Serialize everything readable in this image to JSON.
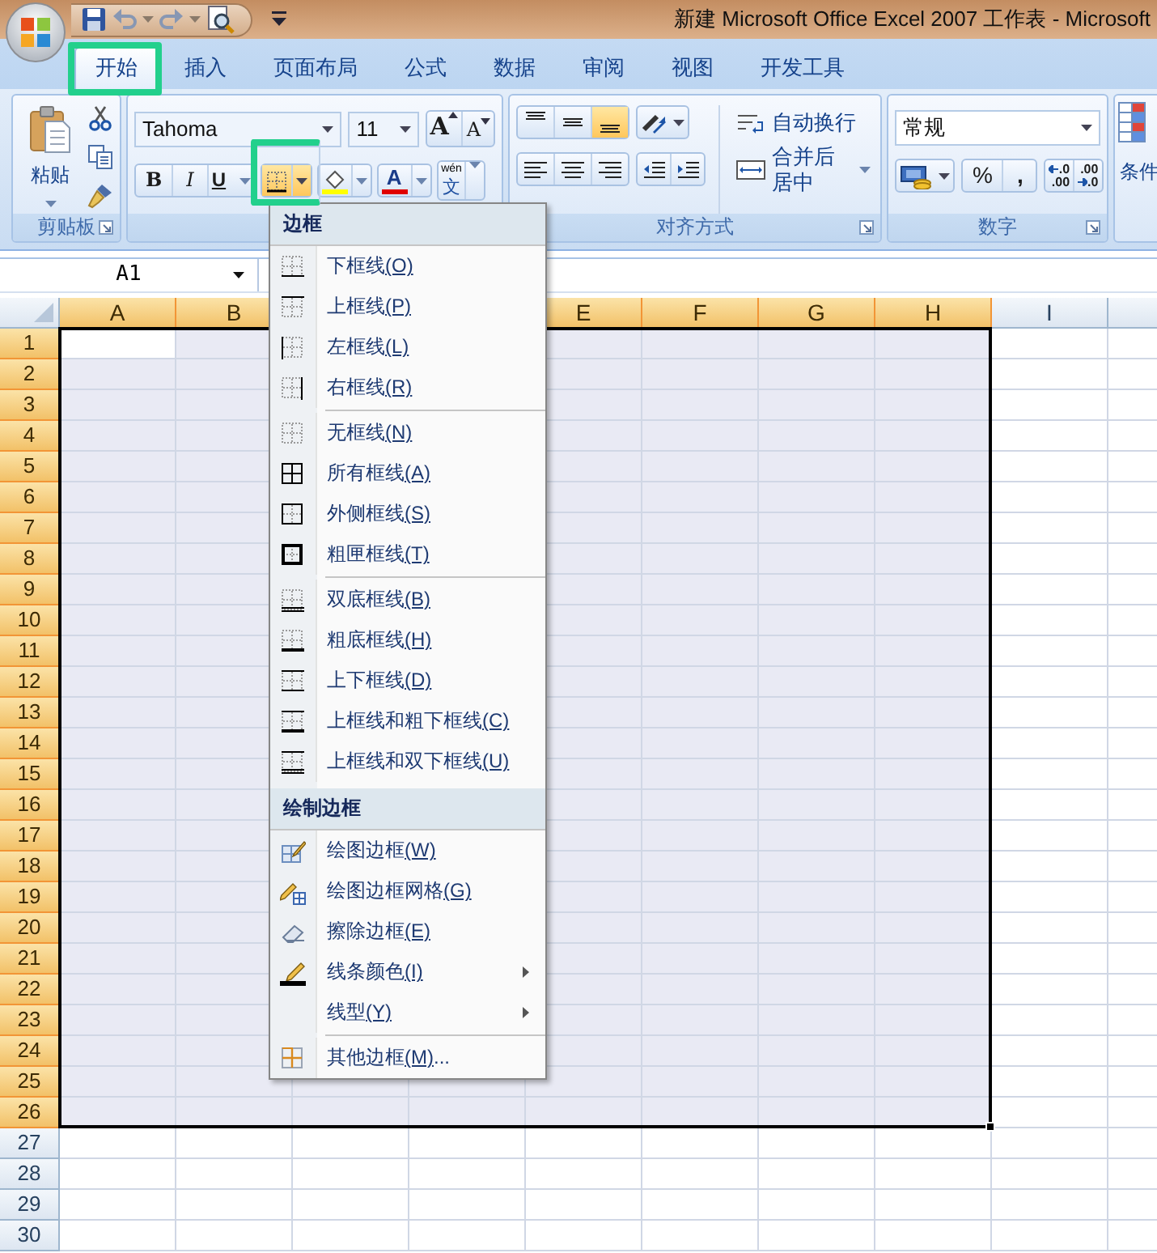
{
  "window": {
    "title": "新建 Microsoft Office Excel 2007 工作表 - Microsoft"
  },
  "tabs": [
    {
      "label": "开始",
      "selected": true,
      "highlighted": true
    },
    {
      "label": "插入",
      "selected": false,
      "highlighted": false
    },
    {
      "label": "页面布局",
      "selected": false,
      "highlighted": false
    },
    {
      "label": "公式",
      "selected": false,
      "highlighted": false
    },
    {
      "label": "数据",
      "selected": false,
      "highlighted": false
    },
    {
      "label": "审阅",
      "selected": false,
      "highlighted": false
    },
    {
      "label": "视图",
      "selected": false,
      "highlighted": false
    },
    {
      "label": "开发工具",
      "selected": false,
      "highlighted": false
    }
  ],
  "ribbon": {
    "clipboard": {
      "paste": "粘贴",
      "label": "剪贴板"
    },
    "font": {
      "font_name": "Tahoma",
      "font_size": "11",
      "grow": "A",
      "shrink": "A",
      "bold": "B",
      "italic": "I",
      "underline": "U",
      "borders": {
        "open": true,
        "highlighted": true
      },
      "font_color": "A",
      "phonetic_top": "wén",
      "phonetic": "文"
    },
    "alignment": {
      "vertical": [
        {
          "selected": false
        },
        {
          "selected": false
        },
        {
          "selected": true
        }
      ],
      "wrap_text": "自动换行",
      "merge": "合并后居中",
      "label": "对齐方式"
    },
    "number": {
      "format": "常规",
      "percent": "%",
      "comma": ",",
      "increase_decimal": [
        ".0",
        ".00"
      ],
      "decrease_decimal": [
        ".00",
        ".0"
      ],
      "label": "数字"
    },
    "styles": {
      "conditional": "条件"
    }
  },
  "name_box": "A1",
  "columns": [
    {
      "label": "A",
      "selected": true,
      "active": true
    },
    {
      "label": "B",
      "selected": true,
      "active": false
    },
    {
      "label": "E",
      "selected": true,
      "active": false
    },
    {
      "label": "F",
      "selected": true,
      "active": false
    },
    {
      "label": "G",
      "selected": true,
      "active": false
    },
    {
      "label": "H",
      "selected": true,
      "active": false
    },
    {
      "label": "I",
      "selected": false,
      "active": false
    }
  ],
  "rows": [
    {
      "label": "1",
      "selected": true,
      "active": true
    },
    {
      "label": "2",
      "selected": true,
      "active": false
    },
    {
      "label": "3",
      "selected": true,
      "active": false
    },
    {
      "label": "4",
      "selected": true,
      "active": false
    },
    {
      "label": "5",
      "selected": true,
      "active": false
    },
    {
      "label": "6",
      "selected": true,
      "active": false
    },
    {
      "label": "7",
      "selected": true,
      "active": false
    },
    {
      "label": "8",
      "selected": true,
      "active": false
    },
    {
      "label": "9",
      "selected": true,
      "active": false
    },
    {
      "label": "10",
      "selected": true,
      "active": false
    },
    {
      "label": "11",
      "selected": true,
      "active": false
    },
    {
      "label": "12",
      "selected": true,
      "active": false
    },
    {
      "label": "13",
      "selected": true,
      "active": false
    },
    {
      "label": "14",
      "selected": true,
      "active": false
    },
    {
      "label": "15",
      "selected": true,
      "active": false
    },
    {
      "label": "16",
      "selected": true,
      "active": false
    },
    {
      "label": "17",
      "selected": true,
      "active": false
    },
    {
      "label": "18",
      "selected": true,
      "active": false
    },
    {
      "label": "19",
      "selected": true,
      "active": false
    },
    {
      "label": "20",
      "selected": true,
      "active": false
    },
    {
      "label": "21",
      "selected": true,
      "active": false
    },
    {
      "label": "22",
      "selected": true,
      "active": false
    },
    {
      "label": "23",
      "selected": true,
      "active": false
    },
    {
      "label": "24",
      "selected": true,
      "active": false
    },
    {
      "label": "25",
      "selected": true,
      "active": false
    },
    {
      "label": "26",
      "selected": true,
      "active": false
    },
    {
      "label": "27",
      "selected": false,
      "active": false
    },
    {
      "label": "28",
      "selected": false,
      "active": false
    },
    {
      "label": "29",
      "selected": false,
      "active": false
    },
    {
      "label": "30",
      "selected": false,
      "active": false
    }
  ],
  "menu": {
    "sections": [
      {
        "heading": "边框",
        "items": [
          {
            "kind": "bottom",
            "label": "下框线",
            "key": "(O)"
          },
          {
            "kind": "top",
            "label": "上框线",
            "key": "(P)"
          },
          {
            "kind": "left",
            "label": "左框线",
            "key": "(L)"
          },
          {
            "kind": "right",
            "label": "右框线",
            "key": "(R)"
          },
          {
            "kind": "none",
            "label": "无框线",
            "key": "(N)",
            "divider": true
          },
          {
            "kind": "all",
            "label": "所有框线",
            "key": "(A)"
          },
          {
            "kind": "outside",
            "label": "外侧框线",
            "key": "(S)"
          },
          {
            "kind": "thick",
            "label": "粗匣框线",
            "key": "(T)"
          },
          {
            "kind": "double-bottom",
            "label": "双底框线",
            "key": "(B)",
            "divider": true
          },
          {
            "kind": "thick-bottom",
            "label": "粗底框线",
            "key": "(H)"
          },
          {
            "kind": "top-bottom",
            "label": "上下框线",
            "key": "(D)"
          },
          {
            "kind": "top-thick-bottom",
            "label": "上框线和粗下框线",
            "key": "(C)"
          },
          {
            "kind": "top-double-bottom",
            "label": "上框线和双下框线",
            "key": "(U)"
          }
        ]
      },
      {
        "heading": "绘制边框",
        "items": [
          {
            "kind": "draw-border",
            "label": "绘图边框",
            "key": "(W)"
          },
          {
            "kind": "draw-grid",
            "label": "绘图边框网格",
            "key": "(G)"
          },
          {
            "kind": "erase",
            "label": "擦除边框",
            "key": "(E)"
          },
          {
            "kind": "line-color",
            "label": "线条颜色",
            "key": "(I)",
            "submenu": true
          },
          {
            "kind": "line-style",
            "label": "线型",
            "key": "(Y)",
            "submenu": true
          },
          {
            "kind": "more",
            "label": "其他边框",
            "key": "(M)",
            "tail": "...",
            "divider": true
          }
        ]
      }
    ]
  }
}
